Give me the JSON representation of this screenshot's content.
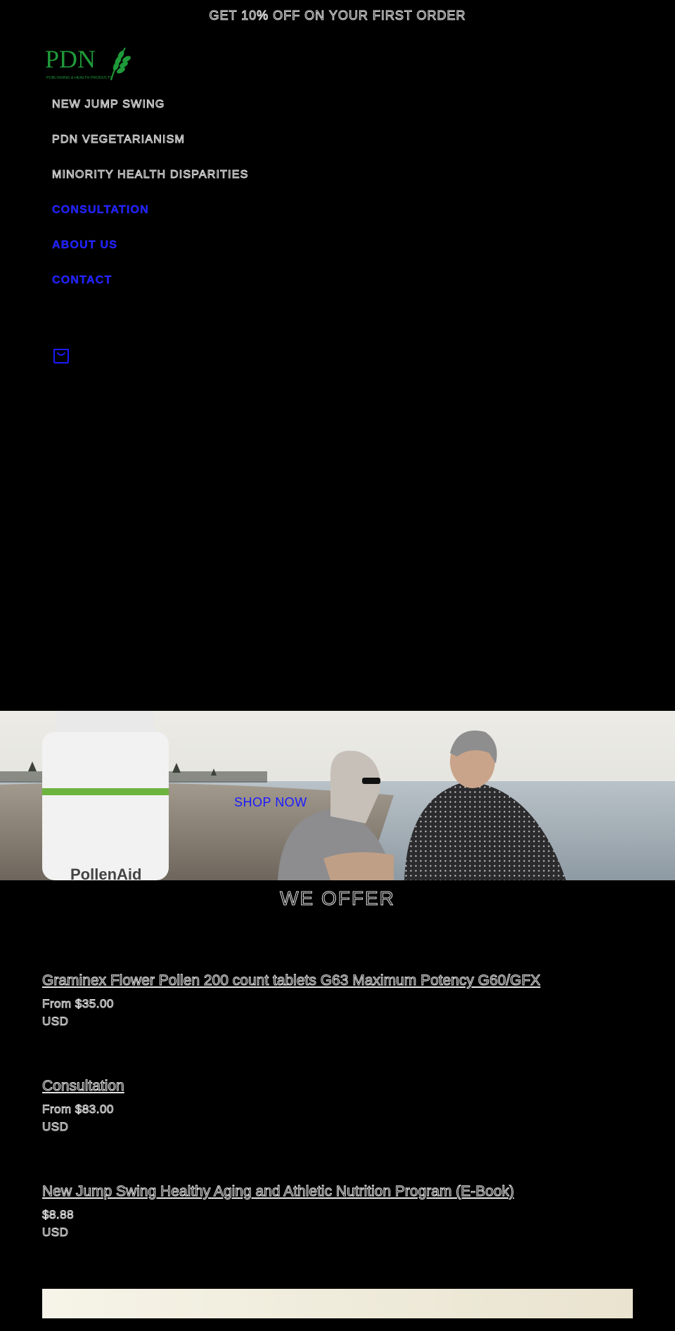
{
  "announcement": {
    "text": "GET 10% OFF ON YOUR FIRST ORDER"
  },
  "logo": {
    "wordmark": "PDN",
    "tagline": "PUBLISHING & HEALTH PRODUCTS"
  },
  "nav": {
    "items": [
      {
        "label": "NEW JUMP SWING"
      },
      {
        "label": "PDN VEGETARIANISM"
      },
      {
        "label": "MINORITY HEALTH DISPARITIES"
      },
      {
        "label": "CONSULTATION"
      },
      {
        "label": "ABOUT US"
      },
      {
        "label": "CONTACT"
      }
    ],
    "cart_icon": "cart-icon"
  },
  "hero": {
    "cta": "SHOP NOW",
    "bottle_label": "PollenAid"
  },
  "offer": {
    "title": "WE OFFER",
    "products": [
      {
        "title": "Graminex Flower Pollen 200 count tablets G63 Maximum Potency G60/GFX",
        "price": "From $35.00",
        "currency": "USD"
      },
      {
        "title": "Consultation",
        "price": "From $83.00",
        "currency": "USD"
      },
      {
        "title": "New Jump Swing Healthy Aging and Athletic Nutrition Program (E-Book)",
        "price": "$8.88",
        "currency": "USD"
      }
    ]
  },
  "colors": {
    "background": "#000000",
    "link_blue": "#1a1aff",
    "logo_green": "#1f9a3a"
  }
}
